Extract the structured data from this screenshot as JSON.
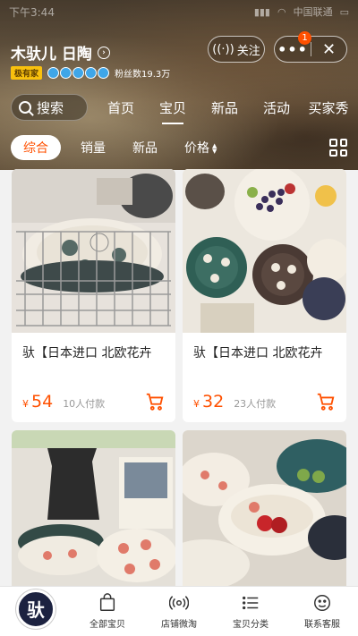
{
  "status_bar": {
    "time": "下午3:44",
    "carrier": "中国联通",
    "signal": "▮▮▮▮",
    "battery": "▭"
  },
  "shop": {
    "name": "木驮儿 日陶",
    "badge": "极有家",
    "fans_label": "粉丝数19.3万",
    "follow_label": "关注",
    "more_label": "•••",
    "close_label": "✕",
    "notification_count": "1"
  },
  "nav": {
    "search_label": "搜索",
    "tabs": [
      {
        "label": "首页"
      },
      {
        "label": "宝贝"
      },
      {
        "label": "新品"
      },
      {
        "label": "活动"
      },
      {
        "label": "买家秀"
      }
    ],
    "active_tab": "宝贝"
  },
  "filters": {
    "items": [
      "综合",
      "销量",
      "新品",
      "价格"
    ],
    "active": "综合",
    "sort_arrows": [
      "▲",
      "▼"
    ]
  },
  "products": [
    {
      "title": "驮【日本进口 北欧花卉",
      "currency": "¥",
      "price": "54",
      "sold": "10人付款",
      "image": "plate-rack-photo"
    },
    {
      "title": "驮【日本进口 北欧花卉",
      "currency": "¥",
      "price": "32",
      "sold": "23人付款",
      "image": "plates-table-photo"
    },
    {
      "title": "",
      "currency": "",
      "price": "",
      "sold": "",
      "image": "pitcher-plates-photo"
    },
    {
      "title": "",
      "currency": "",
      "price": "",
      "sold": "",
      "image": "bowls-cherries-photo"
    }
  ],
  "bottom_nav": {
    "logo_text": "驮",
    "items": [
      {
        "label": "全部宝贝",
        "icon": "shopping-bag-icon"
      },
      {
        "label": "店铺微淘",
        "icon": "broadcast-icon"
      },
      {
        "label": "宝贝分类",
        "icon": "list-icon"
      },
      {
        "label": "联系客服",
        "icon": "service-face-icon"
      }
    ]
  },
  "colors": {
    "accent": "#ff5000",
    "badge": "#f9c10d",
    "logo_bg": "#1c2240"
  }
}
